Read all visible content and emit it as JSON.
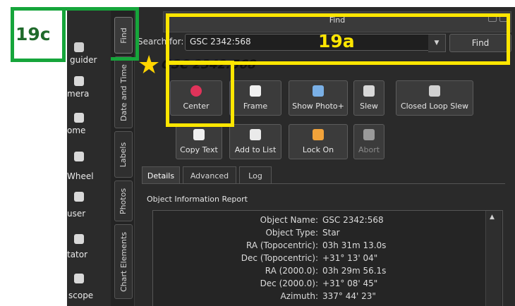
{
  "left_panel": {
    "items": [
      {
        "label": "guider"
      },
      {
        "label": "mera"
      },
      {
        "label": "ome"
      },
      {
        "label": "Wheel"
      },
      {
        "label": "user"
      },
      {
        "label": "tator"
      },
      {
        "label": "scope"
      }
    ]
  },
  "vertical_tabs": [
    "Find",
    "Date and Time",
    "Labels",
    "Photos",
    "Chart Elements"
  ],
  "find_panel": {
    "title": "Find",
    "search_label": "Search for:",
    "search_value": "GSC 2342:568",
    "find_button": "Find",
    "object_title": "GSC 2342:568"
  },
  "actions": {
    "row1": [
      "Center",
      "Frame",
      "Show Photo+",
      "Slew",
      "Closed Loop Slew"
    ],
    "row2": [
      "Copy Text",
      "Add to List",
      "Lock On",
      "Abort"
    ]
  },
  "subtabs": [
    "Details",
    "Advanced",
    "Log"
  ],
  "report": {
    "header": "Object Information Report",
    "rows": [
      {
        "key": "Object Name:",
        "value": "GSC 2342:568"
      },
      {
        "key": "Object Type:",
        "value": "Star"
      },
      {
        "key": "RA (Topocentric):",
        "value": "03h 31m 13.0s"
      },
      {
        "key": "Dec (Topocentric):",
        "value": "+31° 13' 04\""
      },
      {
        "key": "RA (2000.0):",
        "value": "03h 29m 56.1s"
      },
      {
        "key": "Dec (2000.0):",
        "value": "+31° 08' 45\""
      },
      {
        "key": "Azimuth:",
        "value": "337° 44' 23\""
      }
    ]
  },
  "annotations": {
    "green_label": "19c",
    "yellow_label": "19a",
    "green_color": "#16a53b",
    "yellow_color": "#ffe600"
  },
  "icons": {
    "center": "target-icon",
    "frame": "frame-icon",
    "show_photo": "photo-icon",
    "slew": "telescope-icon",
    "closed_loop_slew": "camera-target-icon",
    "copy_text": "copy-icon",
    "add_to_list": "add-list-icon",
    "lock_on": "lock-icon",
    "abort": "abort-telescope-icon",
    "star": "star-icon"
  }
}
